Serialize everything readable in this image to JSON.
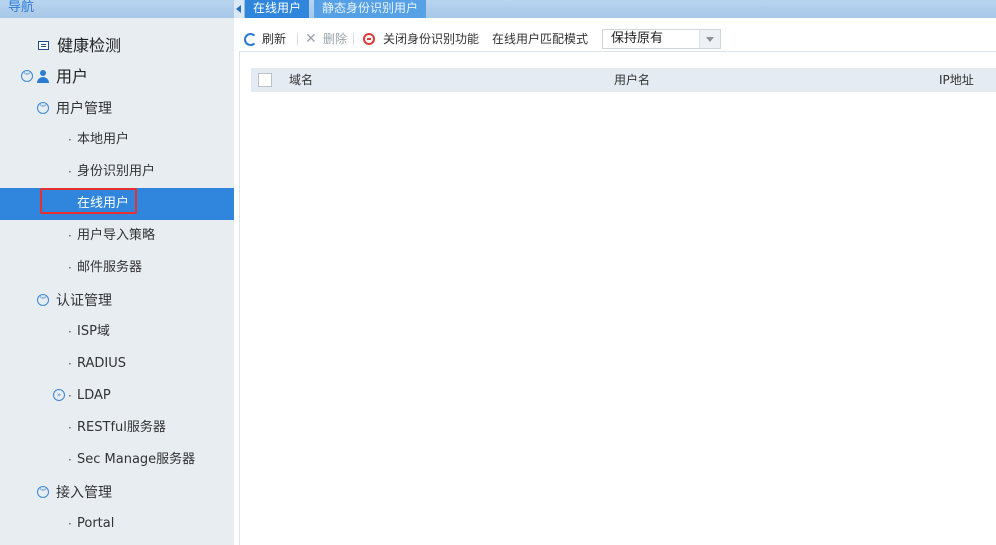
{
  "nav": {
    "title": "导航",
    "items": [
      {
        "label": "健康检测"
      },
      {
        "label": "用户"
      },
      {
        "label": "用户管理"
      },
      {
        "label": "本地用户"
      },
      {
        "label": "身份识别用户"
      },
      {
        "label": "在线用户",
        "active": true
      },
      {
        "label": "用户导入策略"
      },
      {
        "label": "邮件服务器"
      },
      {
        "label": "认证管理"
      },
      {
        "label": "ISP域"
      },
      {
        "label": "RADIUS"
      },
      {
        "label": "LDAP"
      },
      {
        "label": "RESTful服务器"
      },
      {
        "label": "Sec Manage服务器"
      },
      {
        "label": "接入管理"
      },
      {
        "label": "Portal"
      }
    ],
    "bullet": "·"
  },
  "tabs": [
    {
      "label": "在线用户",
      "active": true
    },
    {
      "label": "静态身份识别用户",
      "active": false
    }
  ],
  "toolbar": {
    "refresh_label": "刷新",
    "delete_label": "删除",
    "disable_identity_label": "关闭身份识别功能",
    "match_mode_label": "在线用户匹配模式",
    "match_mode_value": "保持原有"
  },
  "table": {
    "columns": [
      "域名",
      "用户名",
      "IP地址"
    ],
    "rows": []
  },
  "colors": {
    "accent": "#2f86dc",
    "highlight_border": "#e8302e",
    "nav_background": "#e8edf2"
  }
}
